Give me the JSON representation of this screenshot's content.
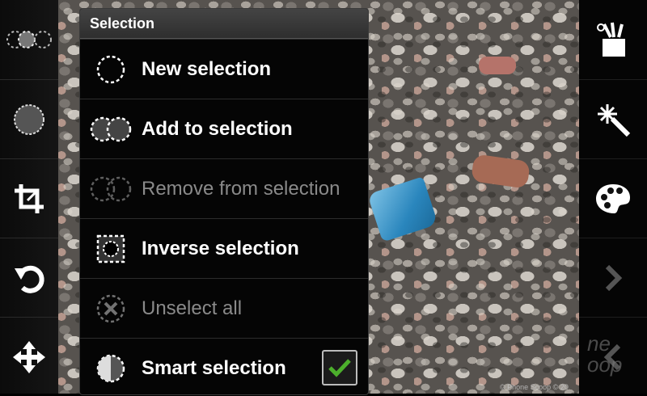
{
  "menu": {
    "title": "Selection",
    "items": [
      {
        "label": "New selection",
        "icon": "new-selection-icon",
        "enabled": true
      },
      {
        "label": "Add to selection",
        "icon": "add-selection-icon",
        "enabled": true
      },
      {
        "label": "Remove from selection",
        "icon": "remove-selection-icon",
        "enabled": false
      },
      {
        "label": "Inverse selection",
        "icon": "inverse-selection-icon",
        "enabled": true
      },
      {
        "label": "Unselect all",
        "icon": "unselect-all-icon",
        "enabled": false
      },
      {
        "label": "Smart selection",
        "icon": "smart-selection-icon",
        "enabled": true,
        "checked": true
      }
    ]
  },
  "left_toolbar": [
    "selection-mode-icon",
    "circle-selection-icon",
    "crop-icon",
    "rotate-icon",
    "move-icon"
  ],
  "right_toolbar": [
    "tools-cup-icon",
    "magic-wand-icon",
    "palette-icon",
    "next-arrow-icon",
    "prev-arrow-icon"
  ],
  "watermark": {
    "line1": "ne",
    "line2": "oop"
  },
  "copyright": "© Phone Scoop © 20",
  "colors": {
    "menu_bg": "#050505",
    "title_bar": "#3a3a3a",
    "check_green": "#4caf2c",
    "blue_rock": "#2a86bd"
  }
}
